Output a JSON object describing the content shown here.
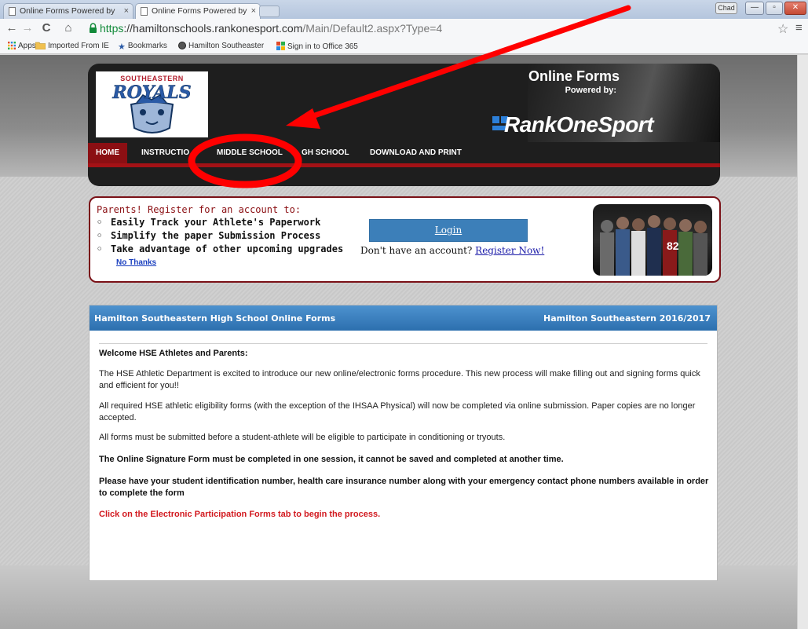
{
  "browser": {
    "tabs": [
      {
        "title": "Online Forms Powered by"
      },
      {
        "title": "Online Forms Powered by"
      }
    ],
    "url": {
      "scheme": "https",
      "host": "://hamiltonschools.rankonesport.com",
      "path": "/Main/Default2.aspx?Type=4"
    },
    "user_badge": "Chad",
    "bookmarks": [
      {
        "label": "Apps"
      },
      {
        "label": "Imported From IE"
      },
      {
        "label": "Bookmarks"
      },
      {
        "label": "Hamilton Southeaster"
      },
      {
        "label": "Sign in to Office 365"
      }
    ]
  },
  "header": {
    "logo_top": "SOUTHEASTERN",
    "logo_main": "ROYALS",
    "title": "Online Forms",
    "powered_by": "Powered by:",
    "brand": "RankOneSport",
    "nav": [
      {
        "label": "HOME"
      },
      {
        "label": "INSTRUCTIO"
      },
      {
        "label": "MIDDLE SCHOOL"
      },
      {
        "label": "GH SCHOOL"
      },
      {
        "label": "DOWNLOAD AND PRINT"
      }
    ]
  },
  "register": {
    "heading": "Parents! Register for an account to:",
    "items": [
      "Easily Track your Athlete's Paperwork",
      "Simplify the paper Submission Process",
      "Take advantage of other upcoming upgrades"
    ],
    "no_thanks": "No Thanks",
    "login": "Login",
    "no_account": "Don't have an account?",
    "register_now": "Register Now!"
  },
  "forms": {
    "title": "Hamilton Southeastern High School Online Forms",
    "season": "Hamilton Southeastern 2016/2017",
    "welcome": "Welcome HSE Athletes and Parents:",
    "p1": "The HSE Athletic Department is excited to introduce our new online/electronic forms procedure. This new process will make filling out and signing forms quick and efficient for you!!",
    "p2": "All required HSE athletic eligibility forms (with the exception of the IHSAA Physical) will now be completed via online submission. Paper copies are no longer accepted.",
    "p3": "All forms must be submitted before a student-athlete will be eligible to participate in conditioning or tryouts.",
    "p4": "The Online Signature Form must be completed in one session, it cannot be saved and completed at another time.",
    "p5": "Please have your student identification number, health care insurance number along with your emergency contact phone numbers available in order to complete the form",
    "p6": "Click on the Electronic Participation Forms tab to begin the process."
  },
  "annotation_color": "#ff0000"
}
